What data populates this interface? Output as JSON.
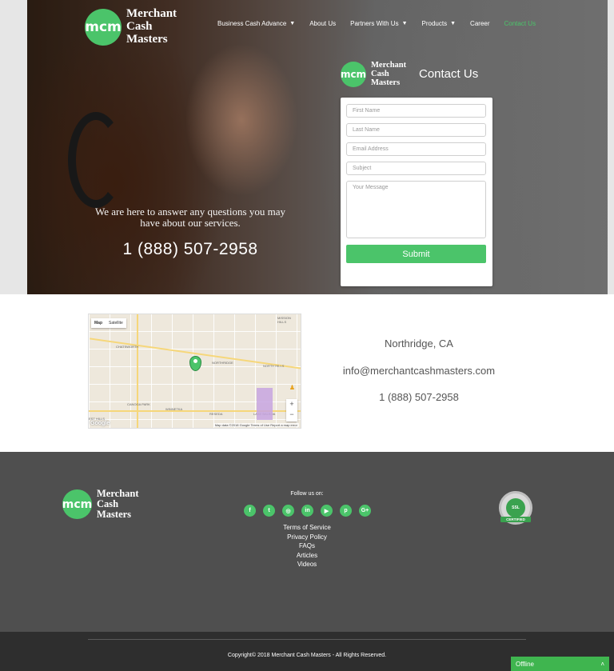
{
  "brand": {
    "logo_mark": "mcm",
    "name_line1": "Merchant",
    "name_line2": "Cash",
    "name_line3": "Masters",
    "accent_color": "#4bc46a"
  },
  "nav": {
    "items": [
      {
        "label": "Business Cash Advance",
        "has_dropdown": true
      },
      {
        "label": "About Us",
        "has_dropdown": false
      },
      {
        "label": "Partners With Us",
        "has_dropdown": true
      },
      {
        "label": "Products",
        "has_dropdown": true
      },
      {
        "label": "Career",
        "has_dropdown": false
      },
      {
        "label": "Contact Us",
        "has_dropdown": false,
        "active": true
      }
    ],
    "caret_icon": "chevron-down-icon"
  },
  "hero": {
    "tagline": "We are here to answer any questions you may have about our services.",
    "phone": "1 (888) 507-2958"
  },
  "contact_form": {
    "title": "Contact Us",
    "first_name_placeholder": "First Name",
    "last_name_placeholder": "Last Name",
    "email_placeholder": "Email Address",
    "subject_placeholder": "Subject",
    "message_placeholder": "Your Message",
    "submit_label": "Submit"
  },
  "map": {
    "tab_map": "Map",
    "tab_satellite": "Satellite",
    "labels": [
      "MISSION HILLS",
      "CHATSWORTH",
      "NORTHRIDGE",
      "NORTH HILLS",
      "CANOGA PARK",
      "WINNETKA",
      "RESEDA",
      "LAKE BALBOA",
      "EST HILLS"
    ],
    "google": "Google",
    "attribution": "Map data ©2018 Google   Terms of Use   Report a map error",
    "zoom_in": "+",
    "zoom_out": "−"
  },
  "info": {
    "city": "Northridge, CA",
    "email": "info@merchantcashmasters.com",
    "phone": "1 (888) 507-2958"
  },
  "footer": {
    "follow_label": "Follow us on:",
    "socials": [
      {
        "icon": "facebook-icon",
        "glyph": "f"
      },
      {
        "icon": "twitter-icon",
        "glyph": "t"
      },
      {
        "icon": "instagram-icon",
        "glyph": "◎"
      },
      {
        "icon": "linkedin-icon",
        "glyph": "in"
      },
      {
        "icon": "youtube-icon",
        "glyph": "▶"
      },
      {
        "icon": "pinterest-icon",
        "glyph": "p"
      },
      {
        "icon": "google-plus-icon",
        "glyph": "G+"
      }
    ],
    "links": [
      "Terms of Service",
      "Privacy Policy",
      "FAQs",
      "Articles",
      "Videos"
    ],
    "badge_top": "SSL",
    "badge_ribbon": "CERTIFIED",
    "copyright": "Copyright© 2018 Merchant Cash Masters - All Rights Reserved."
  },
  "chat": {
    "status": "Offline",
    "toggle_glyph": "˄"
  }
}
